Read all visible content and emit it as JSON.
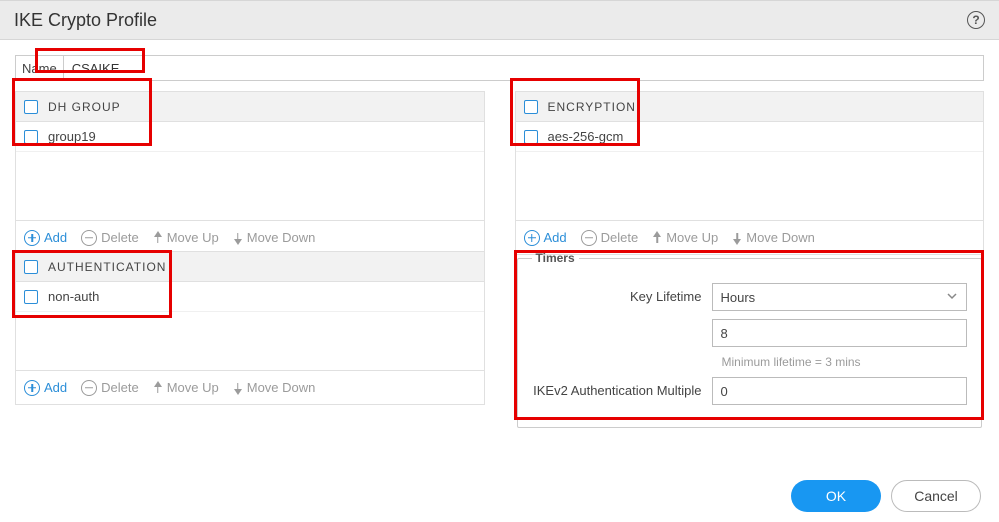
{
  "title": "IKE Crypto Profile",
  "name_field": {
    "label": "Name",
    "value": "CSAIKE"
  },
  "panels": {
    "dh_group": {
      "header": "DH GROUP",
      "rows": [
        "group19"
      ]
    },
    "encryption": {
      "header": "ENCRYPTION",
      "rows": [
        "aes-256-gcm"
      ]
    },
    "authentication": {
      "header": "AUTHENTICATION",
      "rows": [
        "non-auth"
      ]
    }
  },
  "toolbar": {
    "add": "Add",
    "delete": "Delete",
    "move_up": "Move Up",
    "move_down": "Move Down"
  },
  "timers": {
    "legend": "Timers",
    "key_lifetime_label": "Key Lifetime",
    "key_lifetime_unit": "Hours",
    "key_lifetime_value": "8",
    "hint": "Minimum lifetime = 3 mins",
    "ikev2_label": "IKEv2 Authentication Multiple",
    "ikev2_value": "0"
  },
  "buttons": {
    "ok": "OK",
    "cancel": "Cancel"
  },
  "icons": {
    "help": "?",
    "chevron_down": "⌄"
  }
}
